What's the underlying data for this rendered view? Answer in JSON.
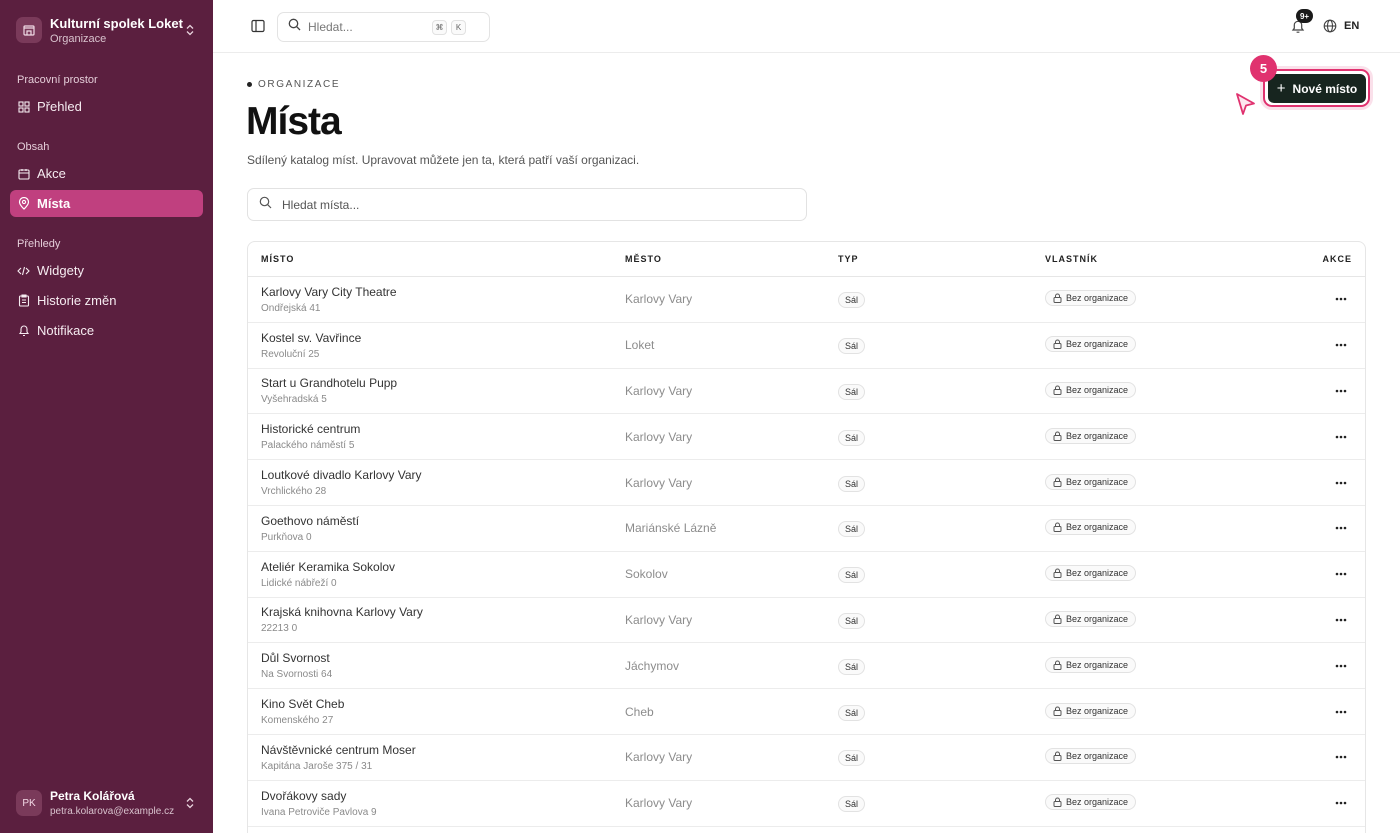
{
  "sidebar": {
    "org_name": "Kulturní spolek Loket",
    "org_sub": "Organizace",
    "sections": [
      "Pracovní prostor",
      "Obsah",
      "Přehledy"
    ],
    "items": [
      {
        "label": "Přehled",
        "icon": "grid-icon"
      },
      {
        "label": "Akce",
        "icon": "calendar-icon"
      },
      {
        "label": "Místa",
        "icon": "map-pin-icon",
        "active": true
      },
      {
        "label": "Widgety",
        "icon": "code-icon"
      },
      {
        "label": "Historie změn",
        "icon": "clipboard-icon"
      },
      {
        "label": "Notifikace",
        "icon": "bell-icon"
      }
    ],
    "user": {
      "initials": "PK",
      "name": "Petra Kolářová",
      "email": "petra.kolarova@example.cz"
    }
  },
  "topbar": {
    "search_placeholder": "Hledat...",
    "kbd1": "⌘",
    "kbd2": "K",
    "notif_badge": "9+",
    "lang": "EN"
  },
  "page": {
    "eyebrow": "ORGANIZACE",
    "title": "Místa",
    "subtitle": "Sdílený katalog míst. Upravovat můžete jen ta, která patří vaší organizaci.",
    "new_button": "Nové místo",
    "step_badge": "5",
    "search_placeholder": "Hledat místa..."
  },
  "table": {
    "headers": [
      "MÍSTO",
      "MĚSTO",
      "TYP",
      "VLASTNÍK",
      "AKCE"
    ],
    "rows": [
      {
        "name": "Karlovy Vary City Theatre",
        "address": "Ondřejská 41",
        "city": "Karlovy Vary",
        "type": "Sál",
        "owner": "Bez organizace"
      },
      {
        "name": "Kostel sv. Vavřince",
        "address": "Revoluční 25",
        "city": "Loket",
        "type": "Sál",
        "owner": "Bez organizace"
      },
      {
        "name": "Start u Grandhotelu Pupp",
        "address": "Vyšehradská 5",
        "city": "Karlovy Vary",
        "type": "Sál",
        "owner": "Bez organizace"
      },
      {
        "name": "Historické centrum",
        "address": "Palackého náměstí 5",
        "city": "Karlovy Vary",
        "type": "Sál",
        "owner": "Bez organizace"
      },
      {
        "name": "Loutkové divadlo Karlovy Vary",
        "address": "Vrchlického 28",
        "city": "Karlovy Vary",
        "type": "Sál",
        "owner": "Bez organizace"
      },
      {
        "name": "Goethovo náměstí",
        "address": "Purkňova 0",
        "city": "Mariánské Lázně",
        "type": "Sál",
        "owner": "Bez organizace"
      },
      {
        "name": "Ateliér Keramika Sokolov",
        "address": "Lidické nábřeží 0",
        "city": "Sokolov",
        "type": "Sál",
        "owner": "Bez organizace"
      },
      {
        "name": "Krajská knihovna Karlovy Vary",
        "address": "22213 0",
        "city": "Karlovy Vary",
        "type": "Sál",
        "owner": "Bez organizace"
      },
      {
        "name": "Důl Svornost",
        "address": "Na Svornosti 64",
        "city": "Jáchymov",
        "type": "Sál",
        "owner": "Bez organizace"
      },
      {
        "name": "Kino Svět Cheb",
        "address": "Komenského 27",
        "city": "Cheb",
        "type": "Sál",
        "owner": "Bez organizace"
      },
      {
        "name": "Návštěvnické centrum Moser",
        "address": "Kapitána Jaroše 375 / 31",
        "city": "Karlovy Vary",
        "type": "Sál",
        "owner": "Bez organizace"
      },
      {
        "name": "Dvořákovy sady",
        "address": "Ivana Petroviče Pavlova 9",
        "city": "Karlovy Vary",
        "type": "Sál",
        "owner": "Bez organizace"
      }
    ]
  },
  "colors": {
    "sidebar": "#5b1f3f",
    "active": "#c0407f",
    "accent": "#e0326f",
    "button": "#17251f"
  }
}
